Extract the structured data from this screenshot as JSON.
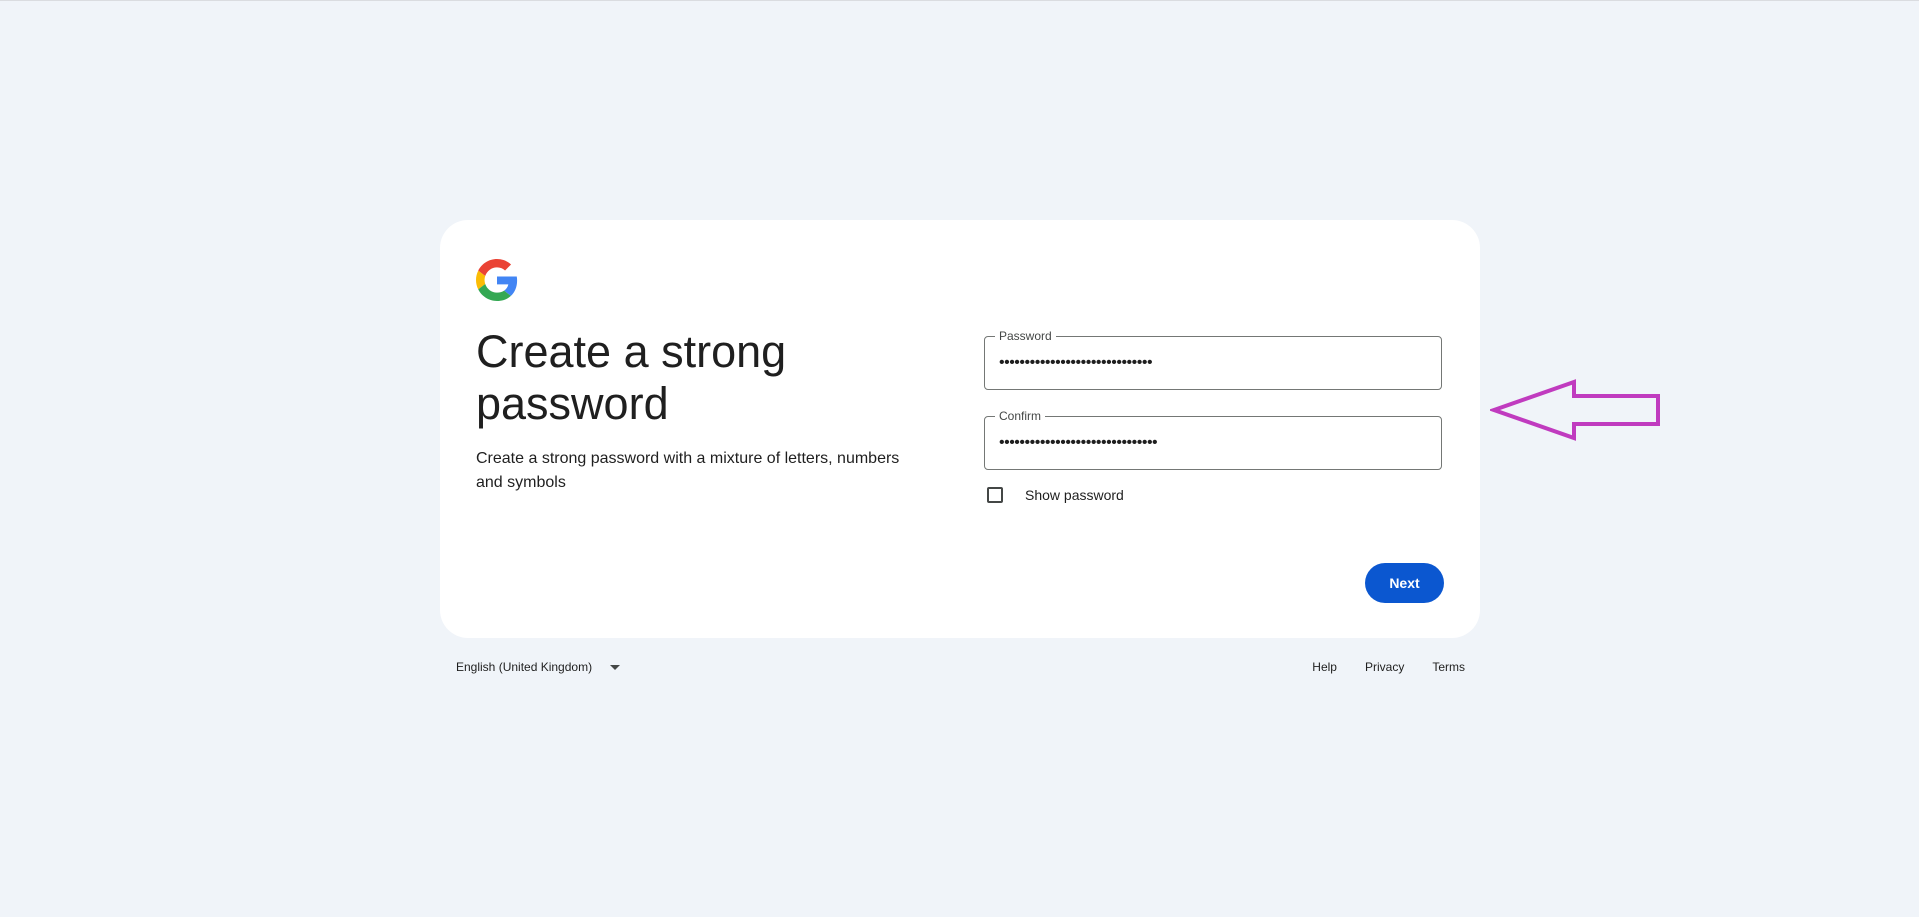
{
  "page": {
    "headline": "Create a strong password",
    "subtext": "Create a strong password with a mixture of letters, numbers and symbols"
  },
  "form": {
    "password": {
      "label": "Password",
      "value": "••••••••••••••••••••••••••••••"
    },
    "confirm": {
      "label": "Confirm",
      "value": "•••••••••••••••••••••••••••••••"
    },
    "show_password_label": "Show password",
    "show_password_checked": false,
    "next_label": "Next"
  },
  "footer": {
    "language": "English (United Kingdom)",
    "links": [
      "Help",
      "Privacy",
      "Terms"
    ]
  },
  "icons": {
    "logo": "google-g-icon",
    "language_dropdown": "caret-down-icon",
    "annotation": "arrow-left-icon"
  },
  "colors": {
    "background": "#f0f4f9",
    "primary_button": "#0b57d0",
    "annotation_arrow": "#c03bbf"
  }
}
